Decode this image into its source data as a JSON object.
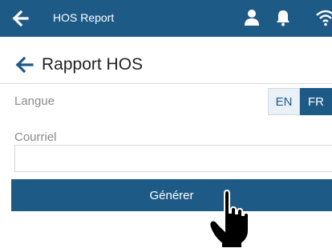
{
  "app_bar": {
    "title": "HOS Report",
    "icons": [
      "back-arrow-icon",
      "user-icon",
      "bell-icon",
      "wifi-icon"
    ],
    "background": "#1e5a86"
  },
  "page": {
    "title": "Rapport HOS"
  },
  "language": {
    "label": "Langue",
    "options": [
      "EN",
      "FR"
    ],
    "selected": "FR"
  },
  "email": {
    "label": "Courriel",
    "value": "",
    "placeholder": ""
  },
  "generate_button": {
    "label": "Générer"
  },
  "cursor": {
    "icon": "hand-pointer-icon"
  }
}
